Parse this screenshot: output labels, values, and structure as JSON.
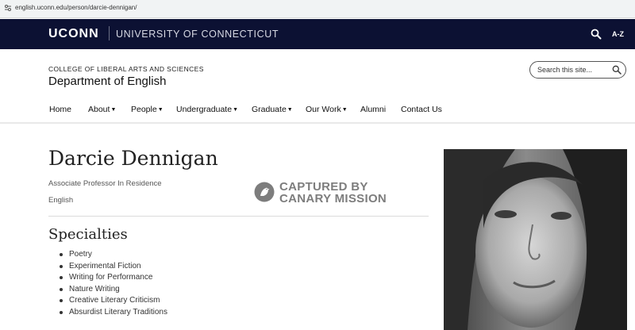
{
  "browser": {
    "url": "english.uconn.edu/person/darcie-dennigan/"
  },
  "header": {
    "wordmark": "UCONN",
    "university": "UNIVERSITY OF CONNECTICUT",
    "az_label": "A-Z"
  },
  "site": {
    "college": "COLLEGE OF LIBERAL ARTS AND SCIENCES",
    "department": "Department of English",
    "search_placeholder": "Search this site..."
  },
  "nav": {
    "items": [
      {
        "label": "Home",
        "dropdown": false
      },
      {
        "label": "About",
        "dropdown": true
      },
      {
        "label": "People",
        "dropdown": true
      },
      {
        "label": "Undergraduate",
        "dropdown": true
      },
      {
        "label": "Graduate",
        "dropdown": true
      },
      {
        "label": "Our Work",
        "dropdown": true
      },
      {
        "label": "Alumni",
        "dropdown": false
      },
      {
        "label": "Contact Us",
        "dropdown": false
      }
    ]
  },
  "profile": {
    "name": "Darcie Dennigan",
    "title": "Associate Professor In Residence",
    "department": "English",
    "specialties_heading": "Specialties",
    "specialties": [
      "Poetry",
      "Experimental Fiction",
      "Writing for Performance",
      "Nature Writing",
      "Creative Literary Criticism",
      "Absurdist Literary Traditions"
    ]
  },
  "watermark": {
    "line1": "CAPTURED BY",
    "line2": "CANARY MISSION"
  },
  "colors": {
    "topbar": "#0c1133",
    "watermark": "#7d7d7d"
  }
}
